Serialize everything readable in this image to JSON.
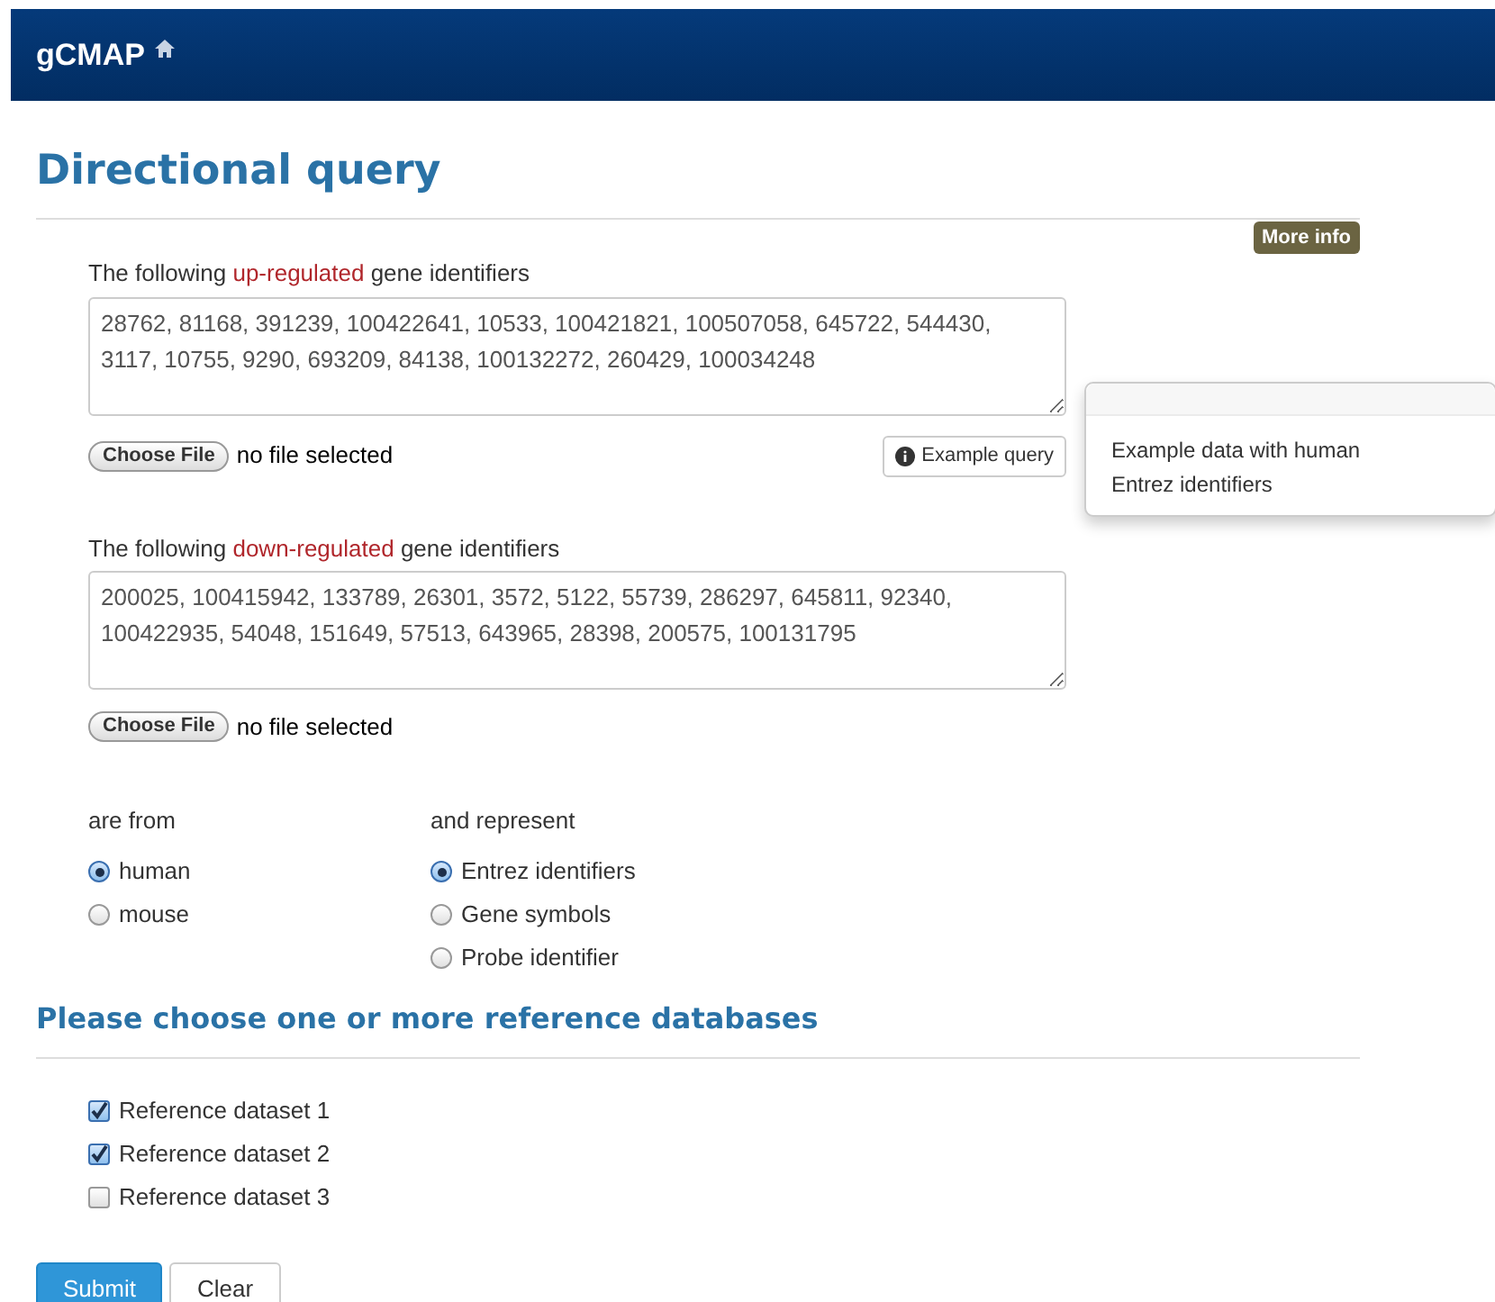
{
  "navbar": {
    "brand": "gCMAP"
  },
  "page_title": "Directional query",
  "more_info": "More info",
  "up": {
    "label": {
      "before": "The following ",
      "highlight": "up-regulated",
      "after": " gene identifiers"
    },
    "value": "28762, 81168, 391239, 100422641, 10533, 100421821, 100507058, 645722, 544430, 3117, 10755, 9290, 693209, 84138, 100132272, 260429, 100034248",
    "file_button": "Choose File",
    "file_status": "no file selected"
  },
  "example_button": "Example query",
  "popover": {
    "text": "Example data with human Entrez identifiers"
  },
  "down": {
    "label": {
      "before": "The following ",
      "highlight": "down-regulated",
      "after": " gene identifiers"
    },
    "value": "200025, 100415942, 133789, 26301, 3572, 5122, 55739, 286297, 645811, 92340, 100422935, 54048, 151649, 57513, 643965, 28398, 200575, 100131795",
    "file_button": "Choose File",
    "file_status": "no file selected"
  },
  "species": {
    "label": "are from",
    "options": [
      {
        "label": "human",
        "selected": true
      },
      {
        "label": "mouse",
        "selected": false
      }
    ]
  },
  "id_type": {
    "label": "and represent",
    "options": [
      {
        "label": "Entrez identifiers",
        "selected": true
      },
      {
        "label": "Gene symbols",
        "selected": false
      },
      {
        "label": "Probe identifier",
        "selected": false
      }
    ]
  },
  "databases": {
    "title": "Please choose one or more reference databases",
    "items": [
      {
        "label": "Reference dataset 1",
        "checked": true
      },
      {
        "label": "Reference dataset 2",
        "checked": true
      },
      {
        "label": "Reference dataset 3",
        "checked": false
      }
    ]
  },
  "buttons": {
    "submit": "Submit",
    "clear": "Clear"
  }
}
